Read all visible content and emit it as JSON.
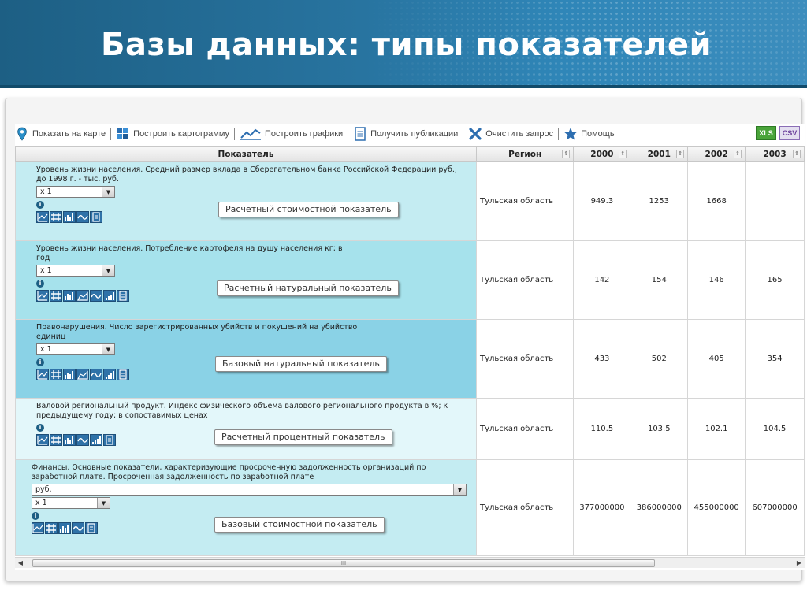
{
  "slide": {
    "title": "Базы данных: типы показателей"
  },
  "toolbar": {
    "items": [
      {
        "label": "Показать на карте",
        "icon": "map-pin-icon"
      },
      {
        "label": "Построить картограмму",
        "icon": "cartogram-icon"
      },
      {
        "label": "Построить графики",
        "icon": "line-chart-icon"
      },
      {
        "label": "Получить публикации",
        "icon": "document-icon"
      },
      {
        "label": "Очистить запрос",
        "icon": "clear-x-icon"
      },
      {
        "label": "Помощь",
        "icon": "star-help-icon"
      }
    ],
    "exports": [
      "XLS",
      "CSV"
    ]
  },
  "table": {
    "headers": {
      "indicator": "Показатель",
      "region": "Регион",
      "years": [
        "2000",
        "2001",
        "2002",
        "2003"
      ]
    },
    "rows": [
      {
        "text": "Уровень жизни населения. Средний размер вклада в Сберегательном банке Российской Федерации руб.; до 1998 г. - тыс. руб.",
        "unit_select": "",
        "scale_select": "х 1",
        "callout": "Расчетный стоимостной показатель",
        "region": "Тульская область",
        "values": [
          "949.3",
          "1253",
          "1668",
          ""
        ]
      },
      {
        "text": "Уровень жизни населения. Потребление картофеля на душу населения кг; в год",
        "unit_select": "",
        "scale_select": "х 1",
        "callout": "Расчетный натуральный показатель",
        "region": "Тульская область",
        "values": [
          "142",
          "154",
          "146",
          "165"
        ]
      },
      {
        "text": "Правонарушения. Число зарегистрированных убийств и покушений на убийство единиц",
        "unit_select": "",
        "scale_select": "х 1",
        "callout": "Базовый натуральный показатель",
        "region": "Тульская область",
        "values": [
          "433",
          "502",
          "405",
          "354"
        ]
      },
      {
        "text": "Валовой региональный продукт. Индекс физического объема валового регионального продукта в %; к предыдущему году; в сопоставимых ценах",
        "unit_select": "",
        "scale_select": "",
        "callout": "Расчетный процентный показатель",
        "region": "Тульская область",
        "values": [
          "110.5",
          "103.5",
          "102.1",
          "104.5"
        ]
      },
      {
        "text": "Финансы. Основные показатели, характеризующие просроченную задолженность организаций по заработной плате. Просроченная задолженность по заработной плате",
        "unit_select": "руб.",
        "scale_select": "х 1",
        "callout": "Базовый стоимостной показатель",
        "region": "Тульская область",
        "values": [
          "377000000",
          "386000000",
          "455000000",
          "607000000"
        ]
      }
    ]
  },
  "scrollbar": {
    "grip": "III"
  }
}
